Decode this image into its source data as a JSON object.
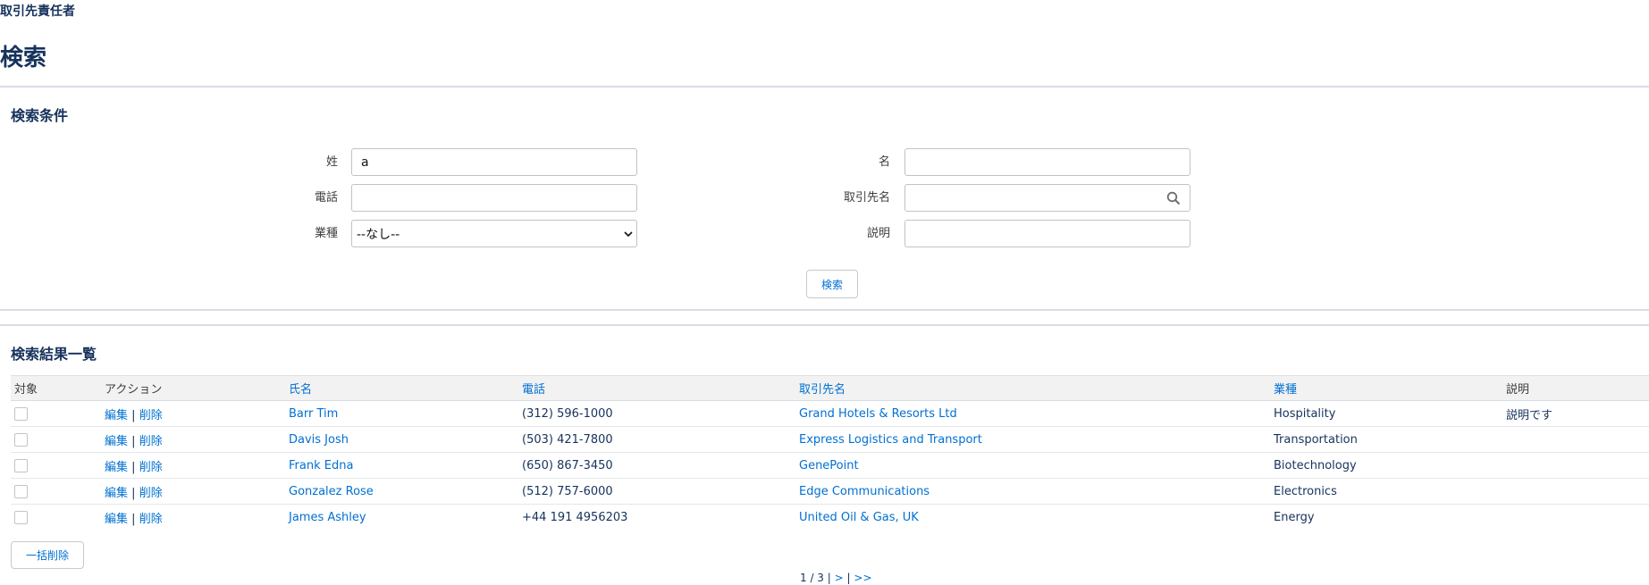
{
  "header": {
    "breadcrumb": "取引先責任者",
    "title": "検索"
  },
  "search": {
    "section_title": "検索条件",
    "fields": {
      "last_name": {
        "label": "姓",
        "value": "a"
      },
      "first_name": {
        "label": "名",
        "value": ""
      },
      "phone": {
        "label": "電話",
        "value": ""
      },
      "account_name": {
        "label": "取引先名",
        "value": "",
        "icon": "search-icon"
      },
      "industry": {
        "label": "業種",
        "selected": "--なし--"
      },
      "description": {
        "label": "説明",
        "value": ""
      }
    },
    "button_label": "検索"
  },
  "results": {
    "section_title": "検索結果一覧",
    "columns": [
      "対象",
      "アクション",
      "氏名",
      "電話",
      "取引先名",
      "業種",
      "説明"
    ],
    "edit_label": "編集",
    "action_separator": "|",
    "delete_label": "削除",
    "rows": [
      {
        "name": "Barr Tim",
        "phone": "(312) 596-1000",
        "account": "Grand Hotels & Resorts Ltd",
        "industry": "Hospitality",
        "description": "説明です"
      },
      {
        "name": "Davis Josh",
        "phone": "(503) 421-7800",
        "account": "Express Logistics and Transport",
        "industry": "Transportation",
        "description": ""
      },
      {
        "name": "Frank Edna",
        "phone": "(650) 867-3450",
        "account": "GenePoint",
        "industry": "Biotechnology",
        "description": ""
      },
      {
        "name": "Gonzalez Rose",
        "phone": "(512) 757-6000",
        "account": "Edge Communications",
        "industry": "Electronics",
        "description": ""
      },
      {
        "name": "James Ashley",
        "phone": "+44 191 4956203",
        "account": "United Oil & Gas, UK",
        "industry": "Energy",
        "description": ""
      }
    ],
    "bulk_delete_label": "一括削除"
  },
  "pagination": {
    "current": "1 / 3",
    "separator": "|",
    "next": ">",
    "last": ">>"
  },
  "colors": {
    "heading": "#16325c",
    "link": "#0070d2",
    "header_bg": "#f2f2f2",
    "divider": "#d8dde6"
  }
}
